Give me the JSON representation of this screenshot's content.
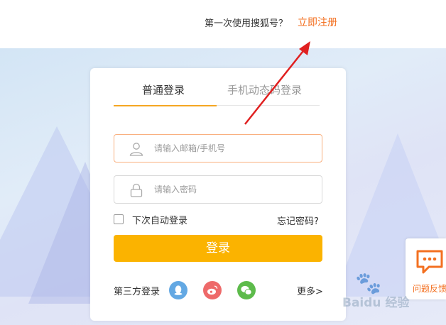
{
  "header": {
    "signup_prompt": "第一次使用搜狐号？",
    "signup_link": "立即注册"
  },
  "login": {
    "tabs": [
      {
        "label": "普通登录",
        "active": true
      },
      {
        "label": "手机动态码登录",
        "active": false
      }
    ],
    "username": {
      "placeholder": "请输入邮箱/手机号",
      "icon": "user-icon"
    },
    "password": {
      "placeholder": "请输入密码",
      "icon": "lock-icon"
    },
    "remember_label": "下次自动登录",
    "forgot_label": "忘记密码?",
    "submit_label": "登录",
    "third_party": {
      "label": "第三方登录",
      "providers": [
        {
          "name": "QQ",
          "icon": "qq-icon",
          "color": "#63a8e3"
        },
        {
          "name": "Weibo",
          "icon": "weibo-icon",
          "color": "#ee6a6a"
        },
        {
          "name": "WeChat",
          "icon": "wechat-icon",
          "color": "#5dbb4b"
        }
      ],
      "more_label": "更多>"
    }
  },
  "feedback": {
    "label": "问题反馈",
    "icon": "chat-bubble-icon"
  },
  "watermark": {
    "text": "Baidu 经验",
    "icon": "paw-icon"
  },
  "colors": {
    "accent": "#f37021",
    "button": "#fbb300",
    "tab_underline": "#f5a623"
  }
}
